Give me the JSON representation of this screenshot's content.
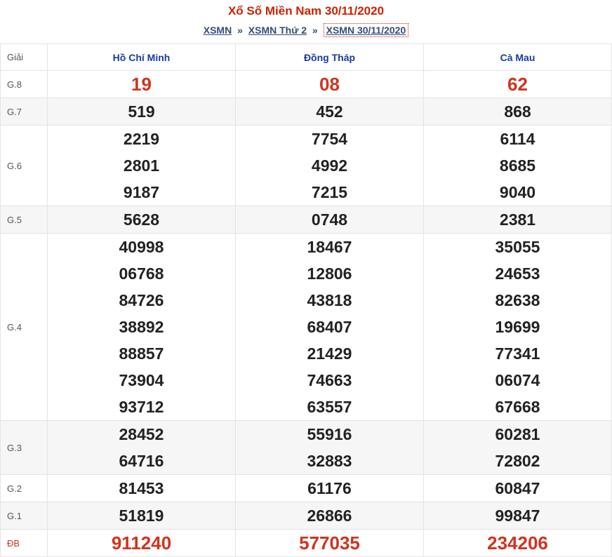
{
  "title": "Xổ Số Miền Nam 30/11/2020",
  "breadcrumb": {
    "items": [
      "XSMN",
      "XSMN Thứ 2",
      "XSMN 30/11/2020"
    ],
    "separator": "»"
  },
  "table": {
    "header_label": "Giải",
    "provinces": [
      "Hồ Chí Minh",
      "Đồng Tháp",
      "Cà Mau"
    ],
    "prizes": [
      {
        "label": "G.8",
        "values": [
          [
            "19"
          ],
          [
            "08"
          ],
          [
            "62"
          ]
        ]
      },
      {
        "label": "G.7",
        "values": [
          [
            "519"
          ],
          [
            "452"
          ],
          [
            "868"
          ]
        ]
      },
      {
        "label": "G.6",
        "values": [
          [
            "2219",
            "2801",
            "9187"
          ],
          [
            "7754",
            "4992",
            "7215"
          ],
          [
            "6114",
            "8685",
            "9040"
          ]
        ]
      },
      {
        "label": "G.5",
        "values": [
          [
            "5628"
          ],
          [
            "0748"
          ],
          [
            "2381"
          ]
        ]
      },
      {
        "label": "G.4",
        "values": [
          [
            "40998",
            "06768",
            "84726",
            "38892",
            "88857",
            "73904",
            "93712"
          ],
          [
            "18467",
            "12806",
            "43818",
            "68407",
            "21429",
            "74663",
            "63557"
          ],
          [
            "35055",
            "24653",
            "82638",
            "19699",
            "77341",
            "06074",
            "67668"
          ]
        ]
      },
      {
        "label": "G.3",
        "values": [
          [
            "28452",
            "64716"
          ],
          [
            "55916",
            "32883"
          ],
          [
            "60281",
            "72802"
          ]
        ]
      },
      {
        "label": "G.2",
        "values": [
          [
            "81453"
          ],
          [
            "61176"
          ],
          [
            "60847"
          ]
        ]
      },
      {
        "label": "G.1",
        "values": [
          [
            "51819"
          ],
          [
            "26866"
          ],
          [
            "99847"
          ]
        ]
      },
      {
        "label": "ĐB",
        "values": [
          [
            "911240"
          ],
          [
            "577035"
          ],
          [
            "234206"
          ]
        ]
      }
    ]
  },
  "colors": {
    "accent": "#cc2200",
    "header_text": "#1a3a9e",
    "number": "#222222"
  }
}
